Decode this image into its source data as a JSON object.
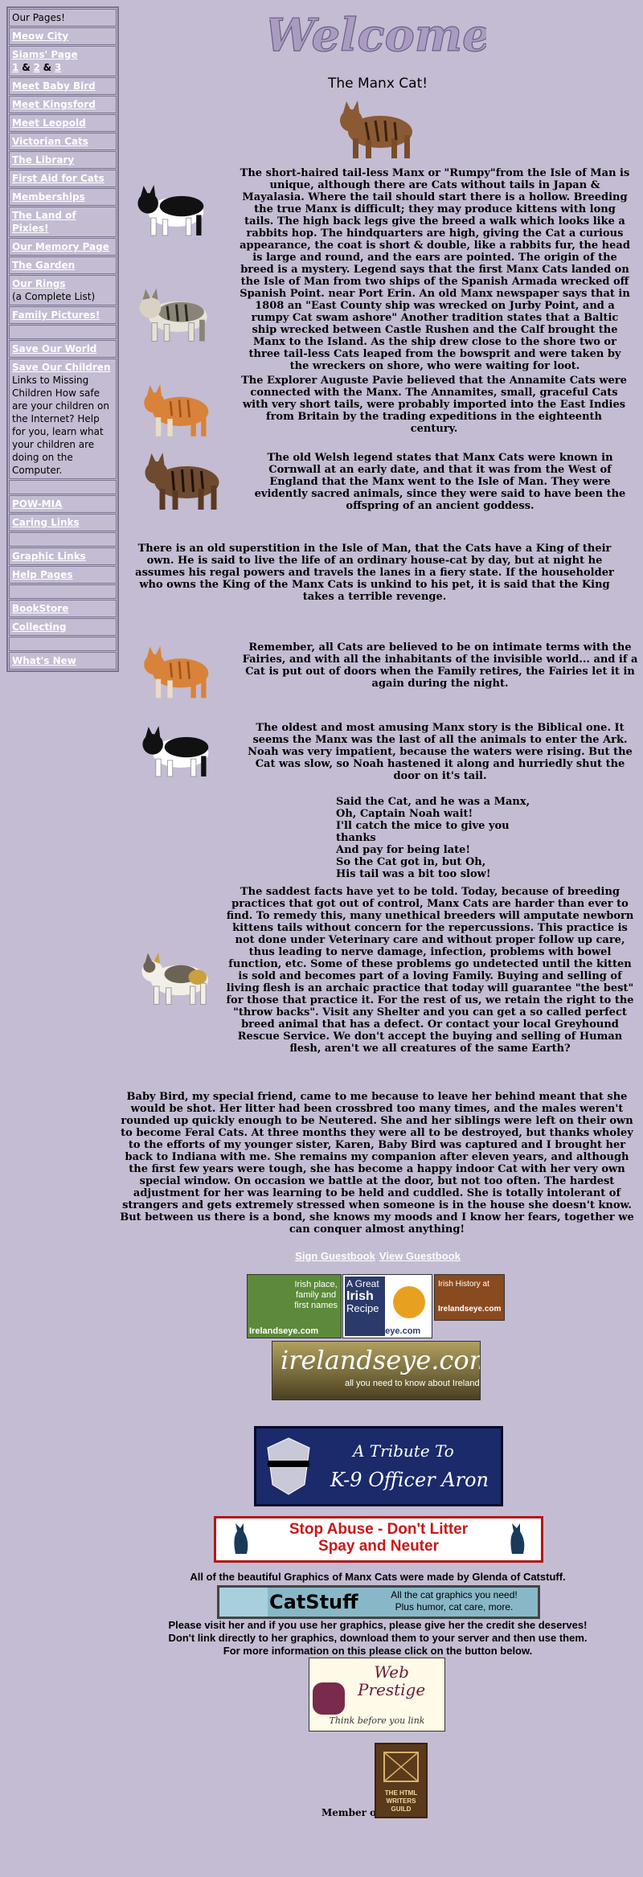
{
  "sidebar": {
    "items": [
      {
        "label": "Our Pages!",
        "link": false
      },
      {
        "label": "Meow City",
        "link": true
      },
      {
        "label": "Siams' Page",
        "link": true
      },
      {
        "label": "Meet Baby Bird",
        "link": true
      },
      {
        "label": "Meet Kingsford",
        "link": true
      },
      {
        "label": "Meet Leopold",
        "link": true
      },
      {
        "label": "Victorian Cats",
        "link": true
      },
      {
        "label": "The Library",
        "link": true
      },
      {
        "label": "First Aid for Cats",
        "link": true
      },
      {
        "label": "Memberships",
        "link": true
      },
      {
        "label": "The Land of Pixies!",
        "link": true
      },
      {
        "label": "Our Memory Page",
        "link": true
      },
      {
        "label": "The Garden",
        "link": true
      },
      {
        "label": "Our Rings",
        "link": true
      },
      {
        "label": "Family Pictures!",
        "link": true
      },
      {
        "label": "Save Our World",
        "link": true
      },
      {
        "label": "Save Our Children",
        "link": true
      },
      {
        "label": "POW-MIA",
        "link": true
      },
      {
        "label": "Caring Links",
        "link": true
      },
      {
        "label": "Graphic Links",
        "link": true
      },
      {
        "label": "Help Pages",
        "link": true
      },
      {
        "label": "BookStore",
        "link": true
      },
      {
        "label": "Collecting",
        "link": true
      },
      {
        "label": "What's New",
        "link": true
      }
    ],
    "siams_pages": [
      "1",
      "&",
      "2",
      "&",
      "3"
    ],
    "rings_note": "(a Complete List)",
    "children_note": "Links to Missing Children How safe are your children on the Internet? Help for you, learn what your children are doing on the Computer."
  },
  "header": {
    "wordart": "Welcome",
    "subtitle": "The Manx Cat!"
  },
  "paragraphs": {
    "p1": "The short-haired tail-less Manx or \"Rumpy\"from the Isle of Man is unique, although there are Cats without tails in Japan & Mayalasia. Where the tail should start there is a hollow. Breeding the true Manx is difficult; they may produce kittens with long tails. The high back legs give the breed a walk which looks like a rabbits hop. The hindquarters are high, giving the Cat a curious appearance, the coat is short & double, like a rabbits fur, the head is large and round, and the ears are pointed. The origin of the breed is a mystery. Legend says that the first Manx Cats landed on the Isle of Man from two ships of the Spanish Armada wrecked off Spanish Point. near Port Erin. An old Manx newspaper says that in 1808 an \"East County ship was wrecked on Jurby Point, and a rumpy Cat swam ashore\" Another tradition states that a Baltic ship wrecked between Castle Rushen and the Calf brought the Manx to the Island. As the ship drew close to the shore two or three tail-less Cats leaped from the bowsprit and were taken by the wreckers on shore, who were waiting for loot.",
    "p2": "The Explorer Auguste Pavie believed that the Annamite Cats were connected with the Manx. The Annamites, small, graceful Cats with very short tails, were probably imported into the East Indies from Britain by the trading expeditions in the eighteenth century.",
    "p3": "The old Welsh legend states that Manx Cats were known in Cornwall at an early date, and that it was from the West of England that the Manx went to the Isle of Man. They were evidently sacred animals, since they were said to have been the offspring of an ancient goddess.",
    "p4": "There is an old superstition in the Isle of Man, that the Cats have a King of their own. He is said to live the life of an ordinary house-cat by day, but at night he assumes his regal powers and travels the lanes in a fiery state. If the householder who owns the King of the Manx Cats is unkind to his pet, it is said that the King takes a terrible revenge.",
    "p5": "Remember, all Cats are believed to be on intimate terms with the Fairies, and with all the inhabitants of the invisible world... and if a Cat is put out of doors when the Family retires, the Fairies let it in again during the night.",
    "p6": "The oldest and most amusing Manx story is the Biblical one. It seems the Manx was the last of all the animals to enter the Ark. Noah was very impatient, because the waters were rising. But the Cat was slow, so Noah hastened it along and hurriedly shut the door on it's tail.",
    "poem": [
      "Said the Cat, and he was a Manx,",
      "Oh, Captain Noah wait!",
      "I'll catch the mice to give you thanks",
      "And pay for being late!",
      "So the Cat got in, but Oh,",
      "His tail was a bit too slow!"
    ],
    "p7": "The saddest facts have yet to be told. Today, because of breeding practices that got out of control, Manx Cats are harder than ever to find. To remedy this, many unethical breeders will amputate newborn kittens tails without concern for the repercussions. This practice is not done under Veterinary care and without proper follow up care, thus leading to nerve damage, infection, problems with bowel function, etc. Some of these problems go undetected until the kitten is sold and becomes part of a loving Family. Buying and selling of living flesh is an archaic practice that today will guarantee \"the best\" for those that practice it. For the rest of us, we retain the right to the \"throw backs\". Visit any Shelter and you can get a so called perfect breed animal that has a defect. Or contact your local Greyhound Rescue Service. We don't accept the buying and selling of Human flesh, aren't we all creatures of the same Earth?",
    "p8": "Baby Bird, my special friend, came to me because to leave her behind meant that she would be shot. Her litter had been crossbred too many times, and the males weren't rounded up quickly enough to be Neutered. She and her siblings were left on their own to become Feral Cats. At three months they were all to be destroyed, but thanks wholey to the efforts of my younger sister, Karen, Baby Bird was captured and I brought her back to Indiana with me. She remains my companion after eleven years, and although the first few years were tough, she has become a happy indoor Cat with her very own special window. On occasion we battle at the door, but not too often. The hardest adjustment for her was learning to be held and cuddled. She is totally intolerant of strangers and gets extremely stressed when someone is in the house she doesn't know. But between us there is a bond, she knows my moods and I know her fears, together we can conquer almost anything!"
  },
  "guestbook": {
    "sign": "Sign Guestbook",
    "view": "View Guestbook"
  },
  "banners": {
    "irish1": [
      "Irish place,",
      "family and",
      "first names"
    ],
    "irish1_site": "Irelandseye.com",
    "irish2_line1": "A Great",
    "irish2_line2": "Irish",
    "irish2_line3": "Recipe",
    "irish2_site": "Irelandseye.com",
    "irish3_line1": "Irish History at",
    "irish3_site": "Irelandseye.com",
    "irelandseye_big": "irelandseye.com",
    "irelandseye_tag": "all you need to know about Ireland",
    "k9_line1": "A Tribute To",
    "k9_line2": "K-9 Officer Aron",
    "abuse_line1": "Stop Abuse  -  Don't Litter",
    "abuse_line2": "Spay and Neuter",
    "catstuff_name": "CatStuff",
    "catstuff_tag1": "All the cat graphics you need!",
    "catstuff_tag2": "Plus humor, cat care, more.",
    "webprestige_1": "Web",
    "webprestige_2": "Prestige",
    "webprestige_tag": "Think before you link",
    "hwg": "THE HTML WRITERS GUILD"
  },
  "credits": {
    "line1": "All of the beautiful Graphics of Manx Cats were made by Glenda of Catstuff.",
    "line2": "Please visit her and if you use her graphics, please give her the credit she deserves!",
    "line3": "Don't link directly to her graphics, download them to your server and then use them.",
    "line4": "For more information on this please click on the button below.",
    "member_of": "Member of"
  }
}
